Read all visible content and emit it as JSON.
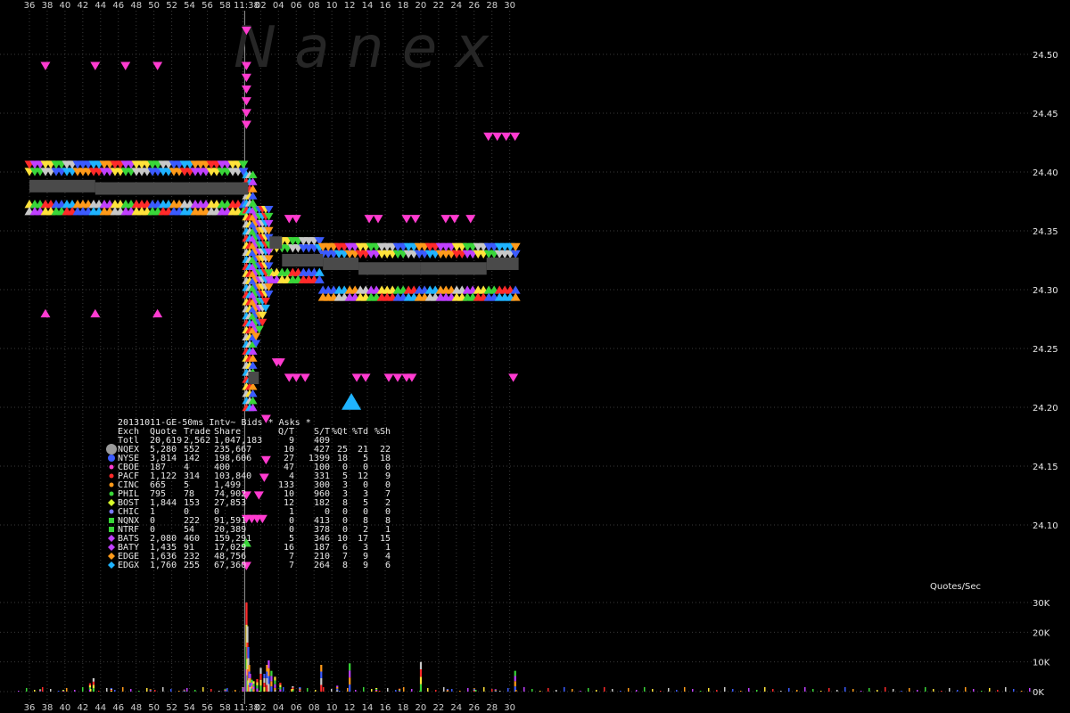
{
  "watermark": "N a n e x",
  "legend_title": "20131011-GE-50ms Intv~ Bids * Asks *",
  "volume_label": "Quotes/Sec",
  "colors": {
    "background": "#000000",
    "grid": "#3a3a3a",
    "nbbo": "#4a4a4a",
    "cursor_line": "#9a9a9a",
    "bids_band": [
      "#3b5bff",
      "#ff2a2a",
      "#39d639",
      "#ffe23a",
      "#c040ff",
      "#c8c8c8",
      "#ff9a1a",
      "#1fb3ff"
    ],
    "asks_band": [
      "#3b5bff",
      "#c8c8c8",
      "#39d639",
      "#ffe23a",
      "#c040ff",
      "#ff2a2a",
      "#ff9a1a",
      "#1fb3ff"
    ]
  },
  "chart_data": {
    "type": "scatter",
    "title": "20131011-GE-50ms Intv~ Bids * Asks *",
    "x_tick_labels": [
      "36",
      "38",
      "40",
      "42",
      "44",
      "46",
      "48",
      "50",
      "52",
      "54",
      "56",
      "58",
      "11:38",
      "02",
      "04",
      "06",
      "08",
      "10",
      "12",
      "14",
      "16",
      "18",
      "20",
      "22",
      "24",
      "26",
      "28",
      "30"
    ],
    "y_tick_labels": [
      "24.50",
      "24.45",
      "24.40",
      "24.35",
      "24.30",
      "24.25",
      "24.20",
      "24.15",
      "24.10"
    ],
    "ylim": [
      24.06,
      24.53
    ],
    "volume_ticks": [
      "0K",
      "10K",
      "20K",
      "30K"
    ],
    "volume_ylim": [
      0,
      32000
    ],
    "table": {
      "columns": [
        "Exch",
        "Quote",
        "Trade",
        "Share",
        "Q/T",
        "S/T",
        "%Qt",
        "%Td",
        "%Sh"
      ],
      "total": [
        "Totl",
        "20,619",
        "2,562",
        "1,047,183",
        "9",
        "409",
        "",
        "",
        ""
      ],
      "rows": [
        {
          "exch": "NQEX",
          "quote": "5,280",
          "trade": "552",
          "share": "235,667",
          "qt": "10",
          "st": "427",
          "pq": "25",
          "pt": "21",
          "ps": "22",
          "color": "#9a9a9a",
          "marker": "circle"
        },
        {
          "exch": "NYSE",
          "quote": "3,814",
          "trade": "142",
          "share": "198,606",
          "qt": "27",
          "st": "1399",
          "pq": "18",
          "pt": "5",
          "ps": "18",
          "color": "#3b5bff",
          "marker": "circle"
        },
        {
          "exch": "CBOE",
          "quote": "187",
          "trade": "4",
          "share": "400",
          "qt": "47",
          "st": "100",
          "pq": "0",
          "pt": "0",
          "ps": "0",
          "color": "#ff3bd0",
          "marker": "dot"
        },
        {
          "exch": "PACF",
          "quote": "1,122",
          "trade": "314",
          "share": "103,840",
          "qt": "4",
          "st": "331",
          "pq": "5",
          "pt": "12",
          "ps": "9",
          "color": "#ff2a2a",
          "marker": "dot"
        },
        {
          "exch": "CINC",
          "quote": "665",
          "trade": "5",
          "share": "1,499",
          "qt": "133",
          "st": "300",
          "pq": "3",
          "pt": "0",
          "ps": "0",
          "color": "#ff9a1a",
          "marker": "dot"
        },
        {
          "exch": "PHIL",
          "quote": "795",
          "trade": "78",
          "share": "74,902",
          "qt": "10",
          "st": "960",
          "pq": "3",
          "pt": "3",
          "ps": "7",
          "color": "#39d639",
          "marker": "dot"
        },
        {
          "exch": "BOST",
          "quote": "1,844",
          "trade": "153",
          "share": "27,853",
          "qt": "12",
          "st": "182",
          "pq": "8",
          "pt": "5",
          "ps": "2",
          "color": "#d8ff2a",
          "marker": "diamond"
        },
        {
          "exch": "CHIC",
          "quote": "1",
          "trade": "0",
          "share": "0",
          "qt": "1",
          "st": "0",
          "pq": "0",
          "pt": "0",
          "ps": "0",
          "color": "#7a7aff",
          "marker": "dot"
        },
        {
          "exch": "NQNX",
          "quote": "0",
          "trade": "222",
          "share": "91,591",
          "qt": "0",
          "st": "413",
          "pq": "0",
          "pt": "8",
          "ps": "8",
          "color": "#39d639",
          "marker": "square"
        },
        {
          "exch": "NTRF",
          "quote": "0",
          "trade": "54",
          "share": "20,389",
          "qt": "0",
          "st": "378",
          "pq": "0",
          "pt": "2",
          "ps": "1",
          "color": "#39d639",
          "marker": "square"
        },
        {
          "exch": "BATS",
          "quote": "2,080",
          "trade": "460",
          "share": "159,291",
          "qt": "5",
          "st": "346",
          "pq": "10",
          "pt": "17",
          "ps": "15",
          "color": "#c040ff",
          "marker": "diamond"
        },
        {
          "exch": "BATY",
          "quote": "1,435",
          "trade": "91",
          "share": "17,029",
          "qt": "16",
          "st": "187",
          "pq": "6",
          "pt": "3",
          "ps": "1",
          "color": "#c040ff",
          "marker": "diamond"
        },
        {
          "exch": "EDGE",
          "quote": "1,636",
          "trade": "232",
          "share": "48,756",
          "qt": "7",
          "st": "210",
          "pq": "7",
          "pt": "9",
          "ps": "4",
          "color": "#ff9a1a",
          "marker": "diamond"
        },
        {
          "exch": "EDGX",
          "quote": "1,760",
          "trade": "255",
          "share": "67,360",
          "qt": "7",
          "st": "264",
          "pq": "8",
          "pt": "9",
          "ps": "6",
          "color": "#1fb3ff",
          "marker": "diamond"
        }
      ]
    },
    "series": [
      {
        "name": "Bids",
        "marker": "triangle-up",
        "segments": [
          {
            "x": [
              0,
              12.3
            ],
            "price": 24.373
          },
          {
            "x": [
              13.6,
              16.5
            ],
            "price": 24.315
          },
          {
            "x": [
              16.5,
              27.5
            ],
            "price": 24.3
          }
        ]
      },
      {
        "name": "Asks",
        "marker": "triangle-down",
        "segments": [
          {
            "x": [
              0,
              12.3
            ],
            "price": 24.4
          },
          {
            "x": [
              13.6,
              16.5
            ],
            "price": 24.335
          },
          {
            "x": [
              16.5,
              27.5
            ],
            "price": 24.33
          }
        ]
      }
    ],
    "crash": {
      "x_start": 12.2,
      "x_end": 13.6,
      "low": 24.2,
      "high": 24.4
    },
    "nbbo_segments": [
      {
        "x": [
          0.0,
          3.7
        ],
        "price": 24.388
      },
      {
        "x": [
          3.7,
          12.3
        ],
        "price": 24.386
      },
      {
        "x": [
          12.3,
          12.9
        ],
        "price": 24.225
      },
      {
        "x": [
          13.5,
          14.2
        ],
        "price": 24.34
      },
      {
        "x": [
          14.2,
          16.5
        ],
        "price": 24.325
      },
      {
        "x": [
          16.5,
          18.5
        ],
        "price": 24.322
      },
      {
        "x": [
          18.5,
          22.0
        ],
        "price": 24.318
      },
      {
        "x": [
          22.0,
          25.7
        ],
        "price": 24.318
      },
      {
        "x": [
          25.7,
          27.5
        ],
        "price": 24.322
      }
    ],
    "outlier_asks": [
      {
        "x": 0.9,
        "price": 24.49
      },
      {
        "x": 3.7,
        "price": 24.49
      },
      {
        "x": 5.4,
        "price": 24.49
      },
      {
        "x": 7.2,
        "price": 24.49
      },
      {
        "x": 12.2,
        "price": 24.52
      },
      {
        "x": 12.2,
        "price": 24.49
      },
      {
        "x": 12.2,
        "price": 24.48
      },
      {
        "x": 12.2,
        "price": 24.47
      },
      {
        "x": 12.2,
        "price": 24.46
      },
      {
        "x": 12.2,
        "price": 24.45
      },
      {
        "x": 12.2,
        "price": 24.44
      },
      {
        "x": 25.8,
        "price": 24.43
      },
      {
        "x": 26.3,
        "price": 24.43
      },
      {
        "x": 26.8,
        "price": 24.43
      },
      {
        "x": 27.3,
        "price": 24.43
      },
      {
        "x": 14.6,
        "price": 24.36
      },
      {
        "x": 15.0,
        "price": 24.36
      },
      {
        "x": 19.1,
        "price": 24.36
      },
      {
        "x": 19.6,
        "price": 24.36
      },
      {
        "x": 21.2,
        "price": 24.36
      },
      {
        "x": 21.7,
        "price": 24.36
      },
      {
        "x": 23.4,
        "price": 24.36
      },
      {
        "x": 23.9,
        "price": 24.36
      },
      {
        "x": 24.8,
        "price": 24.36
      },
      {
        "x": 13.9,
        "price": 24.238
      },
      {
        "x": 14.1,
        "price": 24.238
      },
      {
        "x": 14.6,
        "price": 24.225
      },
      {
        "x": 15.0,
        "price": 24.225
      },
      {
        "x": 15.5,
        "price": 24.225
      },
      {
        "x": 18.4,
        "price": 24.225
      },
      {
        "x": 18.9,
        "price": 24.225
      },
      {
        "x": 20.2,
        "price": 24.225
      },
      {
        "x": 20.7,
        "price": 24.225
      },
      {
        "x": 21.2,
        "price": 24.225
      },
      {
        "x": 21.5,
        "price": 24.225
      },
      {
        "x": 27.2,
        "price": 24.225
      },
      {
        "x": 13.3,
        "price": 24.19
      },
      {
        "x": 13.3,
        "price": 24.155
      },
      {
        "x": 13.2,
        "price": 24.14
      },
      {
        "x": 12.9,
        "price": 24.125
      },
      {
        "x": 12.2,
        "price": 24.125
      },
      {
        "x": 12.2,
        "price": 24.105
      },
      {
        "x": 12.5,
        "price": 24.105
      },
      {
        "x": 12.8,
        "price": 24.105
      },
      {
        "x": 13.1,
        "price": 24.105
      },
      {
        "x": 12.2,
        "price": 24.065
      }
    ],
    "outlier_bids": [
      {
        "x": 0.9,
        "price": 24.28
      },
      {
        "x": 3.7,
        "price": 24.28
      },
      {
        "x": 7.2,
        "price": 24.28
      },
      {
        "x": 18.1,
        "price": 24.205,
        "color": "#1fb3ff",
        "size": "large"
      },
      {
        "x": 12.2,
        "price": 24.085,
        "color": "#39d639"
      }
    ],
    "volume": {
      "spike_x": 12.2,
      "spike_value": 30000,
      "bars": [
        {
          "x": 0.6,
          "v": 900
        },
        {
          "x": 1.9,
          "v": 600
        },
        {
          "x": 3.4,
          "v": 2800
        },
        {
          "x": 3.6,
          "v": 4500
        },
        {
          "x": 4.6,
          "v": 1200
        },
        {
          "x": 6.8,
          "v": 800
        },
        {
          "x": 8.7,
          "v": 700
        },
        {
          "x": 11.0,
          "v": 900
        },
        {
          "x": 12.0,
          "v": 1500
        },
        {
          "x": 12.2,
          "v": 30000
        },
        {
          "x": 12.25,
          "v": 22000
        },
        {
          "x": 12.3,
          "v": 15000
        },
        {
          "x": 12.35,
          "v": 9000
        },
        {
          "x": 12.4,
          "v": 6000
        },
        {
          "x": 12.5,
          "v": 4000
        },
        {
          "x": 12.6,
          "v": 3500
        },
        {
          "x": 12.8,
          "v": 4200
        },
        {
          "x": 13.0,
          "v": 8000
        },
        {
          "x": 13.2,
          "v": 6000
        },
        {
          "x": 13.35,
          "v": 9000
        },
        {
          "x": 13.45,
          "v": 10500
        },
        {
          "x": 13.6,
          "v": 7000
        },
        {
          "x": 13.8,
          "v": 5000
        },
        {
          "x": 14.1,
          "v": 3000
        },
        {
          "x": 14.8,
          "v": 1800
        },
        {
          "x": 15.2,
          "v": 1500
        },
        {
          "x": 16.4,
          "v": 9000
        },
        {
          "x": 17.3,
          "v": 2000
        },
        {
          "x": 18.0,
          "v": 9500
        },
        {
          "x": 19.5,
          "v": 1200
        },
        {
          "x": 20.8,
          "v": 1000
        },
        {
          "x": 22.0,
          "v": 10000
        },
        {
          "x": 23.5,
          "v": 900
        },
        {
          "x": 25.0,
          "v": 1100
        },
        {
          "x": 26.2,
          "v": 800
        },
        {
          "x": 27.3,
          "v": 7000
        }
      ]
    }
  }
}
